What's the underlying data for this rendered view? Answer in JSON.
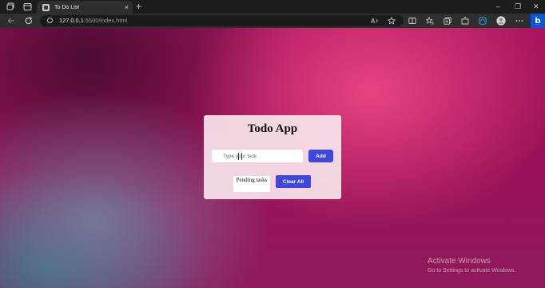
{
  "browser": {
    "tab": {
      "title": "To Do List",
      "close_glyph": "×"
    },
    "new_tab_glyph": "+",
    "window_controls": {
      "minimize": "–",
      "restore": "❐",
      "close": "✕"
    },
    "address": {
      "host": "127.0.0.1",
      "path": ":5500/index.html"
    },
    "bing_label": "b",
    "icons": [
      "workspaces-icon",
      "tab-actions-icon",
      "back-icon",
      "refresh-icon",
      "site-info-icon",
      "read-aloud-icon",
      "favorite-icon",
      "split-screen-icon",
      "favorites-icon",
      "collections-icon",
      "extensions-icon",
      "performance-icon",
      "profile-icon",
      "more-icon",
      "bing-icon"
    ]
  },
  "app": {
    "title": "Todo App",
    "input_placeholder": "Type your task",
    "add_label": "Add",
    "pending_label": "Pending tasks",
    "clear_label": "Clear All"
  },
  "watermark": {
    "title": "Activate Windows",
    "subtitle": "Go to Settings to activate Windows."
  },
  "colors": {
    "accent": "#3f46d8",
    "background_pink": "#a8155e",
    "chrome_dark": "#1c1c1c"
  }
}
